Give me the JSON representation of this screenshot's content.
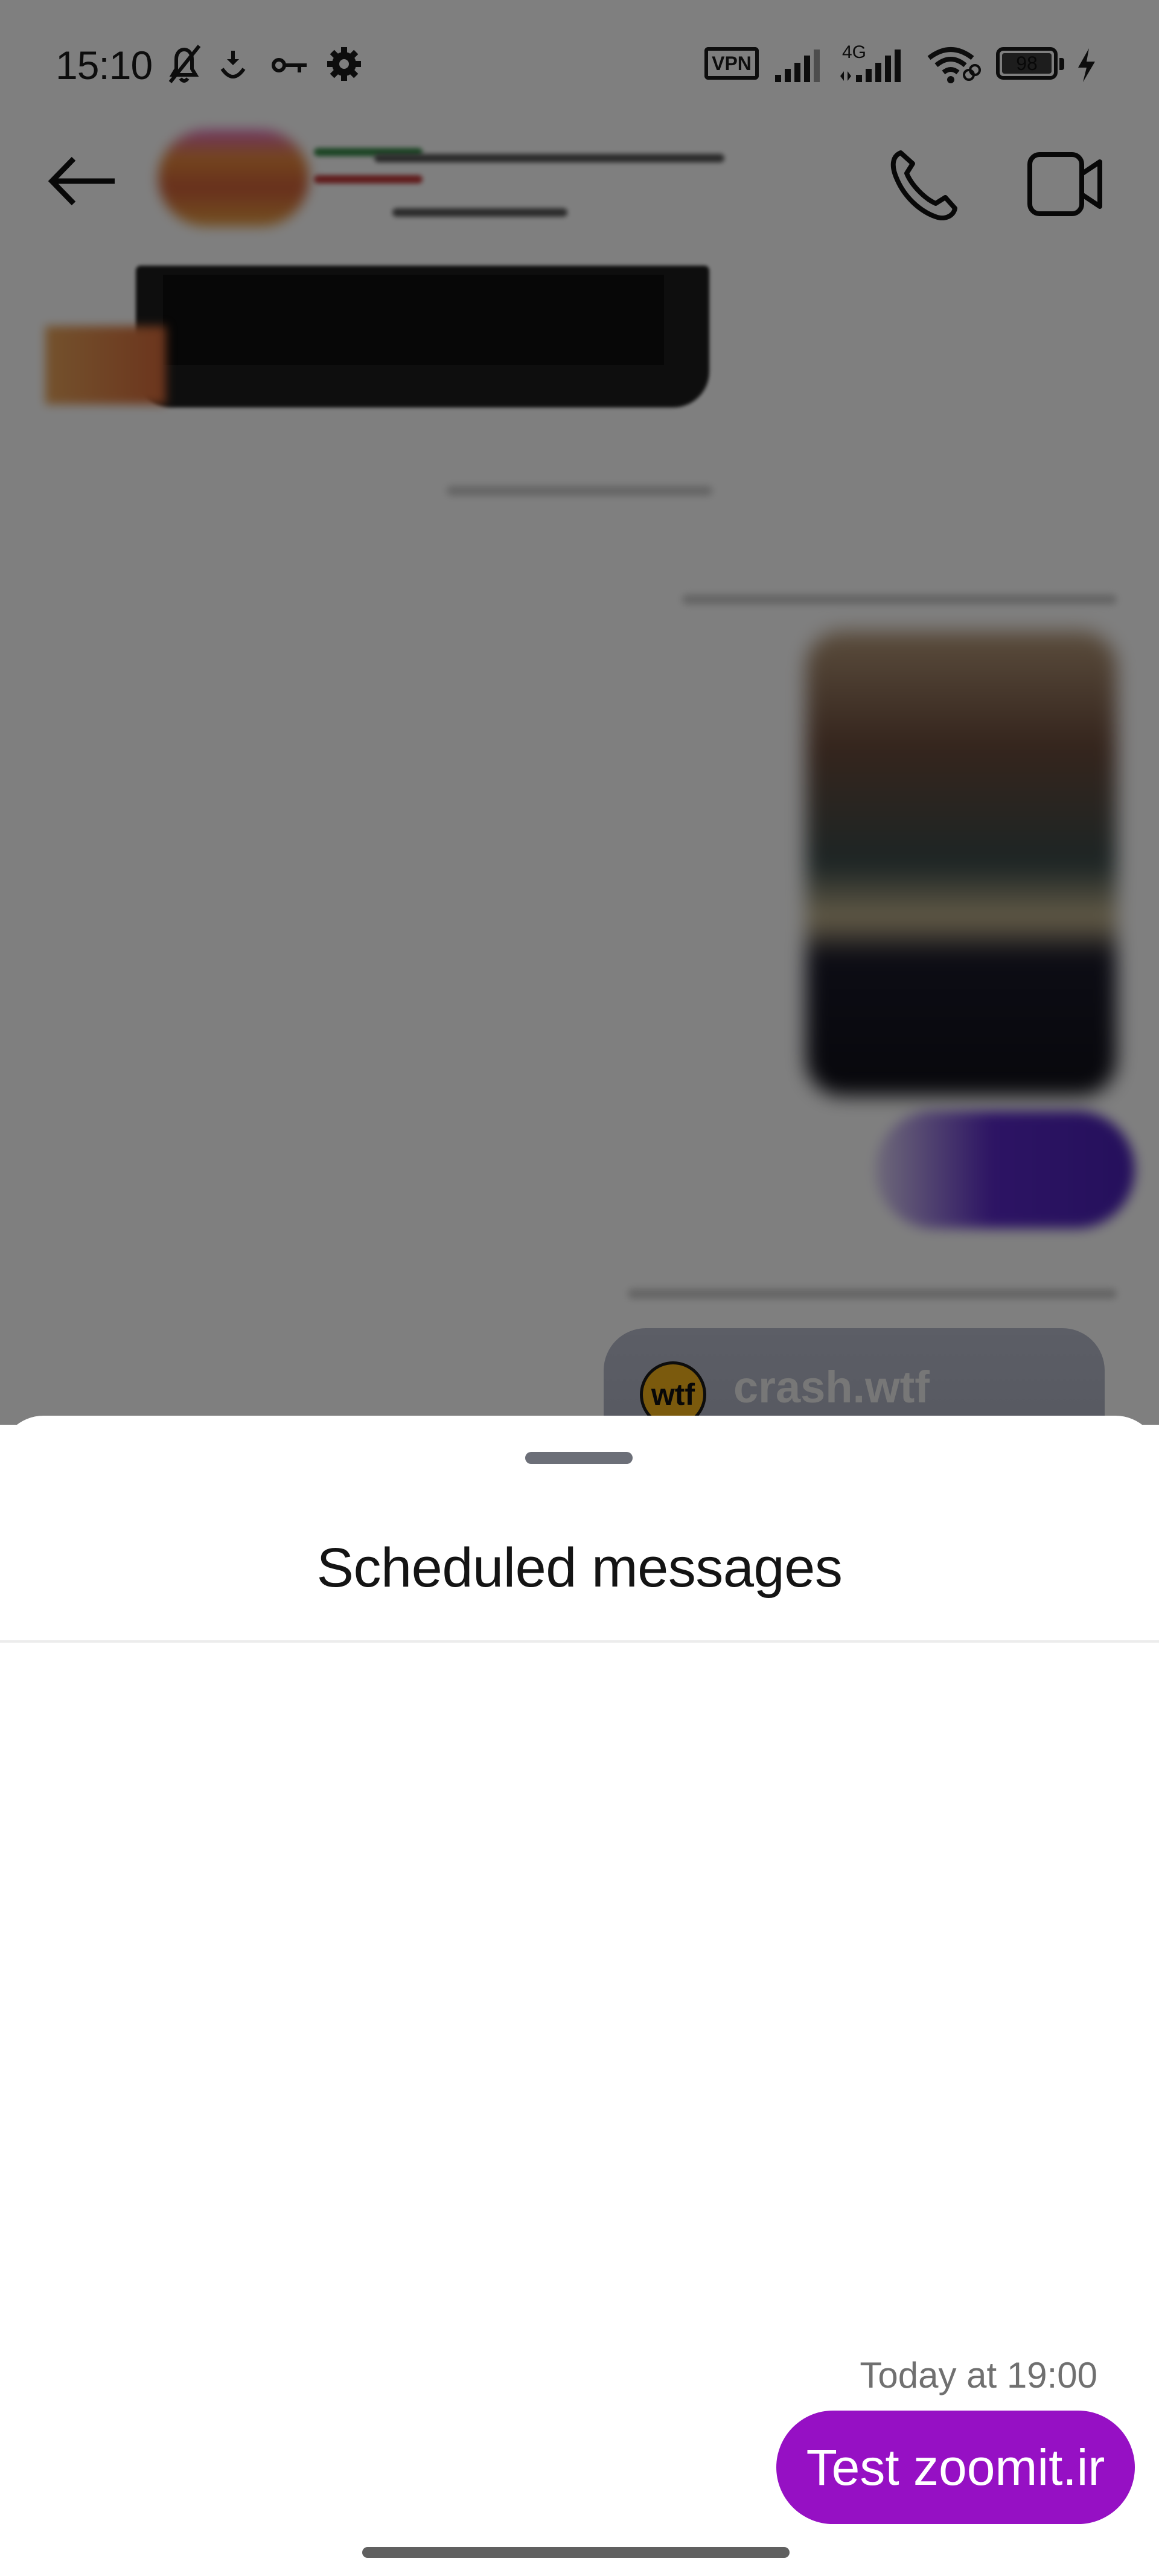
{
  "status_bar": {
    "time": "15:10",
    "icons": [
      "bell-off-icon",
      "download-icon",
      "vpn-key-icon",
      "settings-gear-icon"
    ],
    "vpn_label": "VPN",
    "network_label": "4G",
    "battery_level": "98",
    "charging": true
  },
  "header": {
    "back_icon": "arrow-left-icon",
    "call_icon": "phone-icon",
    "video_icon": "video-camera-icon"
  },
  "chat_background": {
    "link_card": {
      "badge": "wtf",
      "title": "crash.wtf"
    }
  },
  "sheet": {
    "title": "Scheduled messages",
    "messages": [
      {
        "scheduled_time": "Today at 19:00",
        "text": "Test zoomit.ir"
      }
    ]
  },
  "colors": {
    "accent": "#9610c4",
    "scrim": "#7f7f7f",
    "timestamp": "#707070"
  }
}
